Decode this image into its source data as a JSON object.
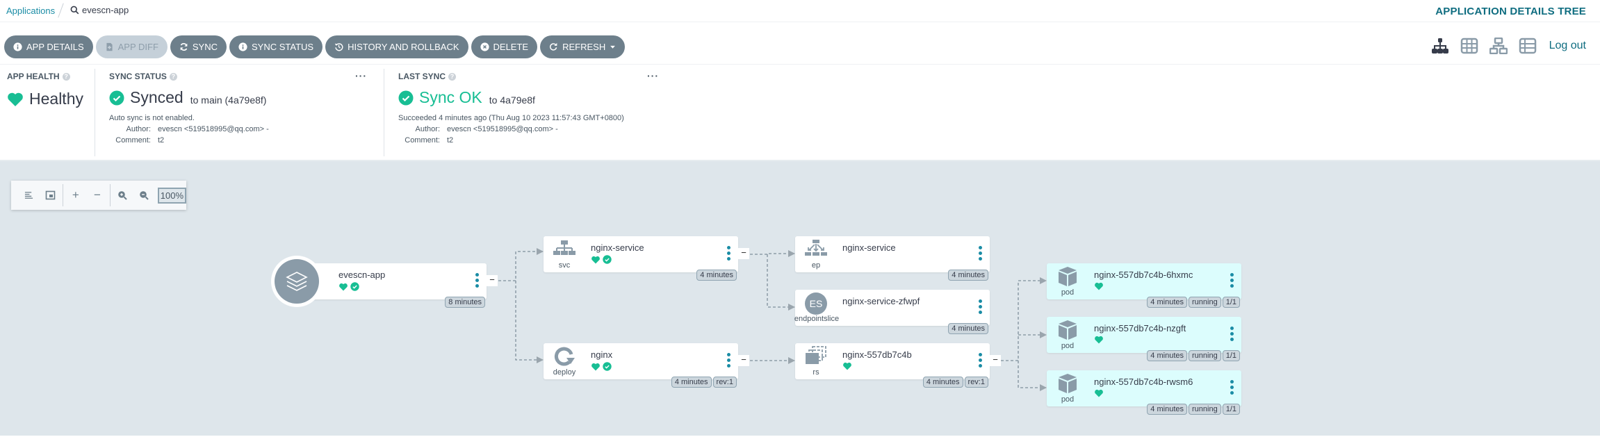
{
  "breadcrumb": {
    "root": "Applications",
    "current": "evescn-app"
  },
  "page_title": "APPLICATION DETAILS TREE",
  "toolbar": {
    "buttons": [
      {
        "label": "APP DETAILS",
        "icon": "info-icon",
        "disabled": false
      },
      {
        "label": "APP DIFF",
        "icon": "file-diff-icon",
        "disabled": true
      },
      {
        "label": "SYNC",
        "icon": "sync-icon",
        "disabled": false
      },
      {
        "label": "SYNC STATUS",
        "icon": "info-icon",
        "disabled": false
      },
      {
        "label": "HISTORY AND ROLLBACK",
        "icon": "history-icon",
        "disabled": false
      },
      {
        "label": "DELETE",
        "icon": "delete-icon",
        "disabled": false
      },
      {
        "label": "REFRESH",
        "icon": "refresh-icon",
        "disabled": false
      }
    ]
  },
  "view_switch": {
    "active": "tree",
    "views": [
      "tree",
      "pods",
      "network",
      "list"
    ],
    "logout_label": "Log out"
  },
  "app_health": {
    "title": "APP HEALTH",
    "status": "Healthy"
  },
  "sync_status": {
    "title": "SYNC STATUS",
    "status": "Synced",
    "target": "to main (4a79e8f)",
    "auto_sync": "Auto sync is not enabled.",
    "author_label": "Author:",
    "author": "evescn <519518995@qq.com> -",
    "comment_label": "Comment:",
    "comment": "t2"
  },
  "last_sync": {
    "title": "LAST SYNC",
    "status": "Sync OK",
    "target": "to 4a79e8f",
    "succeeded": "Succeeded 4 minutes ago (Thu Aug 10 2023 11:57:43 GMT+0800)",
    "author_label": "Author:",
    "author": "evescn <519518995@qq.com> -",
    "comment_label": "Comment:",
    "comment": "t2"
  },
  "zoom_controls": {
    "level": "100%"
  },
  "colors": {
    "healthy": "#18be94",
    "accent": "#0f6d80",
    "button": "#6d7f8b",
    "canvas": "#dee6eb",
    "pod": "#dcfdfd"
  },
  "nodes": {
    "app": {
      "name": "evescn-app",
      "kind": "",
      "tags": [
        "8 minutes"
      ]
    },
    "svc": {
      "name": "nginx-service",
      "kind": "svc",
      "tags": [
        "4 minutes"
      ]
    },
    "deploy": {
      "name": "nginx",
      "kind": "deploy",
      "tags": [
        "4 minutes",
        "rev:1"
      ]
    },
    "ep": {
      "name": "nginx-service",
      "kind": "ep",
      "tags": [
        "4 minutes"
      ]
    },
    "es": {
      "name": "nginx-service-zfwpf",
      "kind": "endpointslice",
      "icon_text": "ES",
      "tags": [
        "4 minutes"
      ]
    },
    "rs": {
      "name": "nginx-557db7c4b",
      "kind": "rs",
      "tags": [
        "4 minutes",
        "rev:1"
      ]
    },
    "pod1": {
      "name": "nginx-557db7c4b-6hxmc",
      "kind": "pod",
      "tags": [
        "4 minutes",
        "running",
        "1/1"
      ]
    },
    "pod2": {
      "name": "nginx-557db7c4b-nzgft",
      "kind": "pod",
      "tags": [
        "4 minutes",
        "running",
        "1/1"
      ]
    },
    "pod3": {
      "name": "nginx-557db7c4b-rwsm6",
      "kind": "pod",
      "tags": [
        "4 minutes",
        "running",
        "1/1"
      ]
    }
  }
}
